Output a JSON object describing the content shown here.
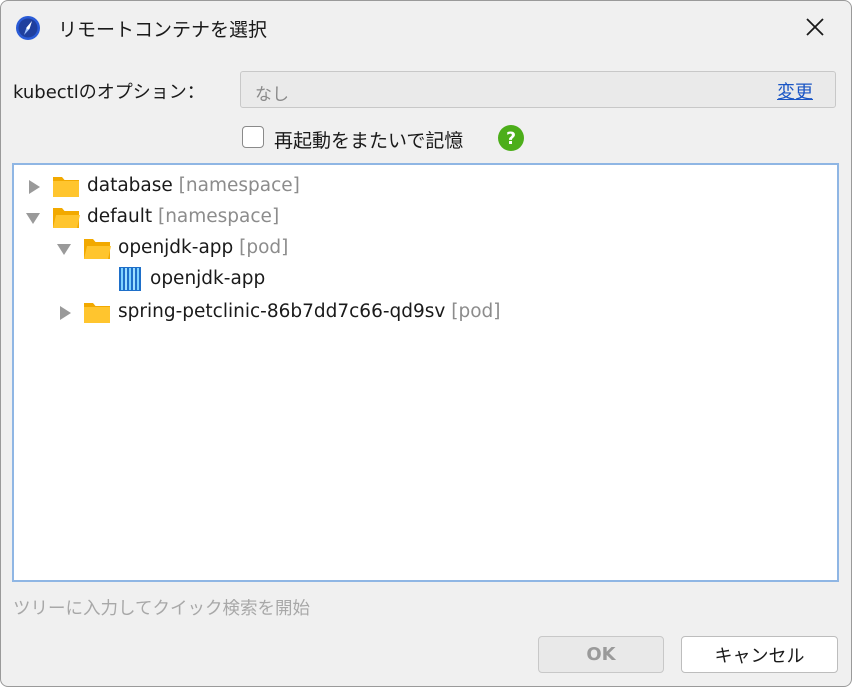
{
  "window": {
    "title": "リモートコンテナを選択",
    "app_icon": "compass-app-icon",
    "close_icon": "close-icon"
  },
  "options": {
    "label": "kubectlのオプション：",
    "value": "なし",
    "change_link": "変更"
  },
  "restart": {
    "label": "再起動をまたいで記憶",
    "checked": false,
    "help_icon": "help-icon",
    "help_color": "#4cae1a"
  },
  "tree": {
    "nodes": [
      {
        "name": "database",
        "type": "[namespace]",
        "expanded": false,
        "icon": "folder-icon"
      },
      {
        "name": "default",
        "type": "[namespace]",
        "expanded": true,
        "icon": "folder-open-icon"
      },
      {
        "name": "openjdk-app",
        "type": "[pod]",
        "expanded": true,
        "icon": "folder-open-icon"
      },
      {
        "name": "openjdk-app",
        "type": "",
        "icon": "container-icon"
      },
      {
        "name": "spring-petclinic-86b7dd7c66-qd9sv",
        "type": "[pod]",
        "expanded": false,
        "icon": "folder-icon"
      }
    ]
  },
  "hint": "ツリーに入力してクイック検索を開始",
  "buttons": {
    "ok": "OK",
    "cancel": "キャンセル"
  },
  "colors": {
    "accent": "#1b56c5",
    "tree_border": "#8fb6e4",
    "folder": "#f6b51e"
  }
}
